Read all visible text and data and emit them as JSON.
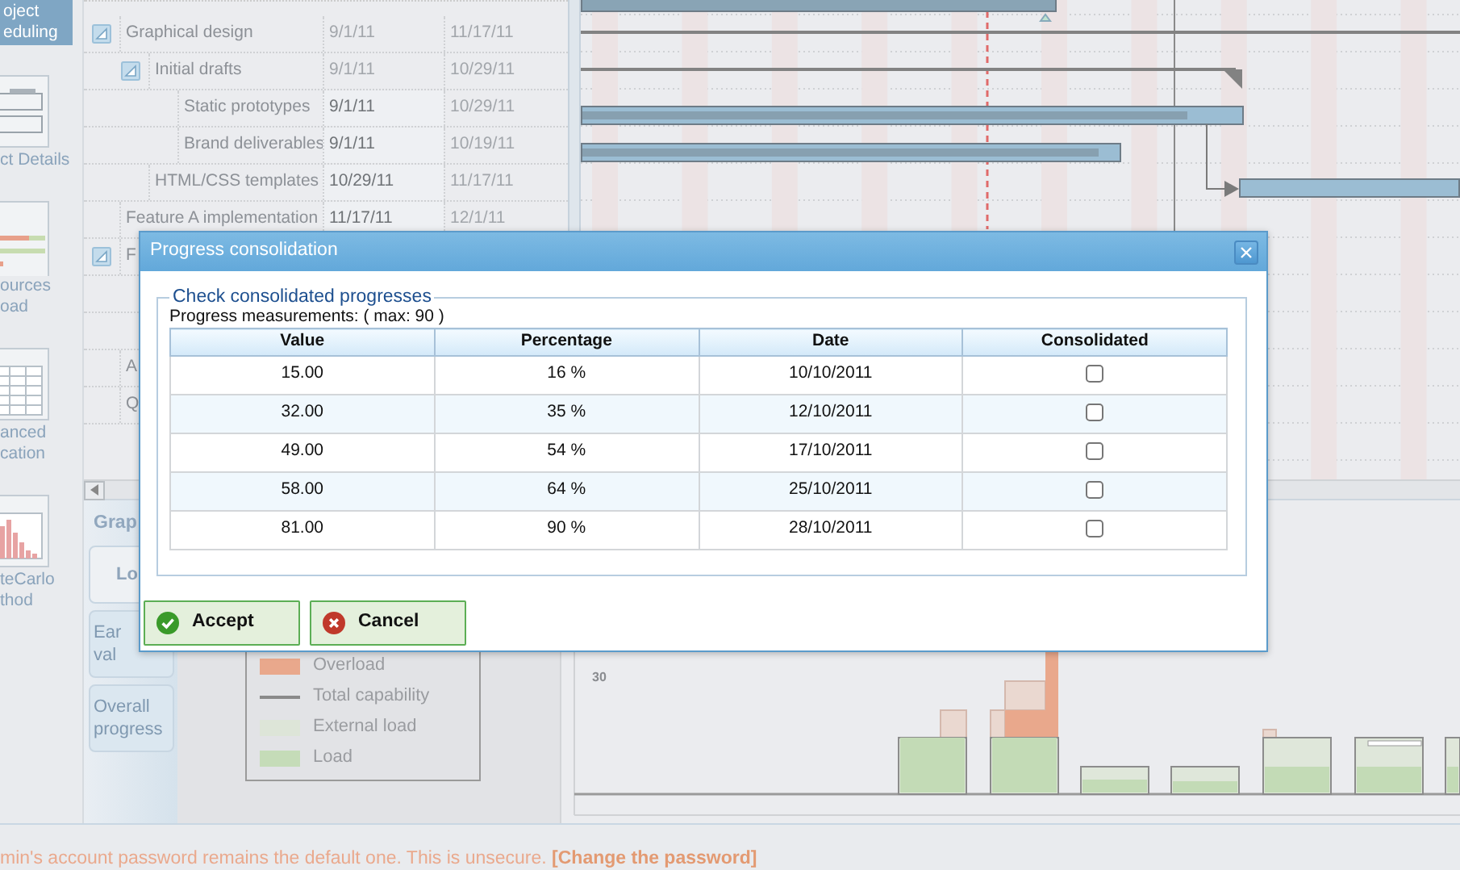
{
  "sidebar": {
    "items": [
      {
        "kind": "none",
        "lines": [
          "oject",
          "eduling"
        ],
        "selected": true
      },
      {
        "kind": "gantt",
        "lines": [
          "ct Details"
        ],
        "selected": false
      },
      {
        "kind": "resources",
        "lines": [
          "ources",
          "oad"
        ],
        "selected": false
      },
      {
        "kind": "grid",
        "lines": [
          "anced",
          "cation"
        ],
        "selected": false
      },
      {
        "kind": "histogram",
        "lines": [
          "teCarlo",
          "thod"
        ],
        "selected": false
      }
    ]
  },
  "tasks": [
    {
      "name": "Graphical design",
      "start": "9/1/11",
      "end": "11/17/11",
      "expanded": true,
      "children": [
        {
          "name": "Initial drafts",
          "start": "9/1/11",
          "end": "10/29/11",
          "expanded": true,
          "children": [
            {
              "name": "Static prototypes",
              "start": "9/1/11",
              "end": "10/29/11"
            },
            {
              "name": "Brand deliverables",
              "start": "9/1/11",
              "end": "10/19/11"
            }
          ]
        },
        {
          "name": "HTML/CSS templates",
          "start": "10/29/11",
          "end": "11/17/11"
        }
      ]
    },
    {
      "name": "Feature A implementation",
      "start": "11/17/11",
      "end": "12/1/11"
    },
    {
      "name": "F",
      "expanded": true
    },
    {
      "name": "A"
    },
    {
      "name": "Q"
    }
  ],
  "graph_panel": {
    "title": "Grap",
    "tabs": [
      {
        "lines": [
          "Lo"
        ],
        "selected": true
      },
      {
        "lines": [
          "Ear",
          "val"
        ],
        "selected": false
      },
      {
        "lines": [
          "Overall",
          "progress"
        ],
        "selected": false
      }
    ]
  },
  "legend": {
    "items": [
      {
        "label": "Overload",
        "kind": "swatch",
        "color": "#e9a88c"
      },
      {
        "label": "Total capability",
        "kind": "line",
        "color": "#8a8a8a"
      },
      {
        "label": "External load",
        "kind": "swatch",
        "color": "#dde5d8"
      },
      {
        "label": "Load",
        "kind": "swatch",
        "color": "#c5dcb8"
      }
    ]
  },
  "load_chart": {
    "y_tick": "30"
  },
  "footer": {
    "message": "min's account password remains the default one. This is unsecure.",
    "link": "[Change the password]"
  },
  "dialog": {
    "title": "Progress consolidation",
    "group_title": "Check consolidated progresses",
    "caption": "Progress measurements: ( max: 90 )",
    "columns": [
      "Value",
      "Percentage",
      "Date",
      "Consolidated"
    ],
    "rows": [
      {
        "value": "15.00",
        "percentage": "16 %",
        "date": "10/10/2011",
        "consolidated": false
      },
      {
        "value": "32.00",
        "percentage": "35 %",
        "date": "12/10/2011",
        "consolidated": false
      },
      {
        "value": "49.00",
        "percentage": "54 %",
        "date": "17/10/2011",
        "consolidated": false
      },
      {
        "value": "58.00",
        "percentage": "64 %",
        "date": "25/10/2011",
        "consolidated": false
      },
      {
        "value": "81.00",
        "percentage": "90 %",
        "date": "28/10/2011",
        "consolidated": false
      }
    ],
    "buttons": [
      {
        "label": "Accept",
        "kind": "accept"
      },
      {
        "label": "Cancel",
        "kind": "cancel"
      }
    ]
  }
}
